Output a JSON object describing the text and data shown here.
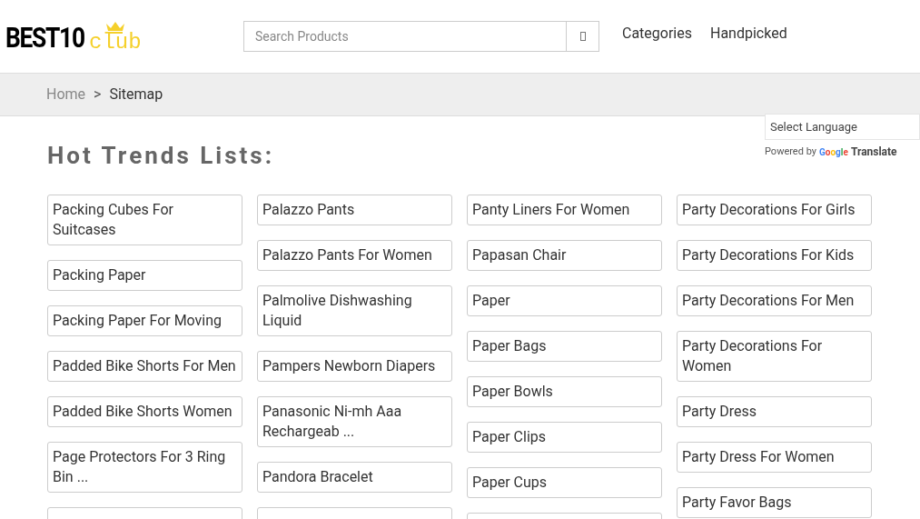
{
  "logo": {
    "brand": "BEST10",
    "suffix": "club"
  },
  "search": {
    "placeholder": "Search Products"
  },
  "nav": [
    "Categories",
    "Handpicked"
  ],
  "breadcrumb": [
    "Home",
    ">",
    "Sitemap"
  ],
  "translate": {
    "select": "Select Language",
    "powered_by": "Powered by",
    "google": "Google",
    "translate": "Translate"
  },
  "heading": "Hot Trends Lists:",
  "columns": [
    [
      "Packing Cubes For Suitcases",
      "Packing Paper",
      "Packing Paper For Moving",
      "Padded Bike Shorts For Men",
      "Padded Bike Shorts Women",
      "Page Protectors For 3 Ring Bin ..."
    ],
    [
      "Palazzo Pants",
      "Palazzo Pants For Women",
      "Palmolive Dishwashing Liquid",
      "Pampers Newborn Diapers",
      "Panasonic Ni-mh Aaa Rechargeab ...",
      "Pandora Bracelet"
    ],
    [
      "Panty Liners For Women",
      "Papasan Chair",
      "Paper",
      "Paper Bags",
      "Paper Bowls",
      "Paper Clips",
      "Paper Cups"
    ],
    [
      "Party Decorations For Girls",
      "Party Decorations For Kids",
      "Party Decorations For Men",
      "Party Decorations For Women",
      "Party Dress",
      "Party Dress For Women",
      "Party Favor Bags"
    ]
  ]
}
